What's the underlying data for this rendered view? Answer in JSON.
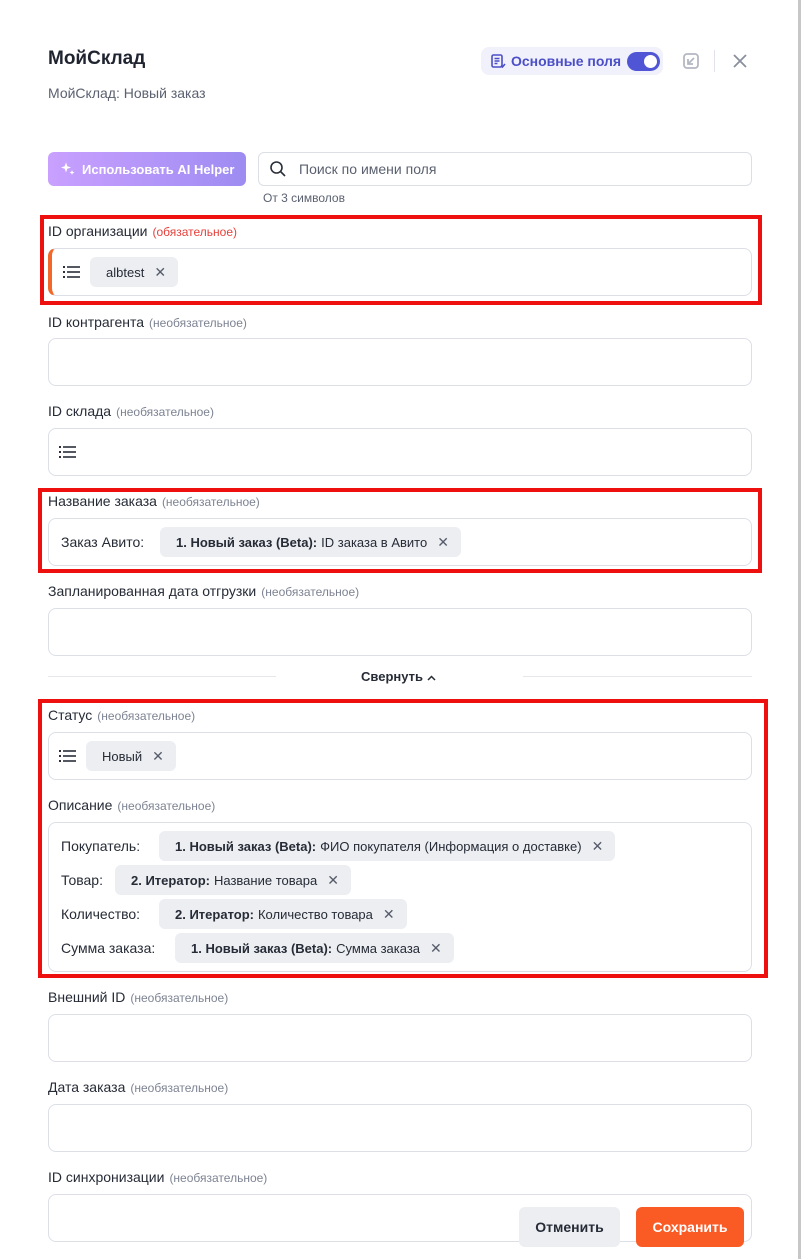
{
  "header": {
    "title": "МойСклад",
    "subtitle": "МойСклад: Новый заказ",
    "fields_toggle_label": "Основные поля",
    "fields_toggle_on": true
  },
  "toolbar": {
    "ai_button_label": "Использовать AI Helper",
    "search_placeholder": "Поиск по имени поля",
    "search_hint": "От 3 символов"
  },
  "fields": {
    "org_id": {
      "label": "ID организации",
      "tag": "(обязательное)",
      "chip": "albtest"
    },
    "counterparty_id": {
      "label": "ID контрагента",
      "tag": "(необязательное)"
    },
    "store_id": {
      "label": "ID склада",
      "tag": "(необязательное)"
    },
    "order_name": {
      "label": "Название заказа",
      "tag": "(необязательное)",
      "prefix": "Заказ Авито:",
      "chip_source": "1. Новый заказ (Beta):",
      "chip_value": "ID заказа в Авито"
    },
    "ship_date": {
      "label": "Запланированная дата отгрузки",
      "tag": "(необязательное)"
    },
    "collapse_label": "Свернуть",
    "status": {
      "label": "Статус",
      "tag": "(необязательное)",
      "chip": "Новый"
    },
    "description": {
      "label": "Описание",
      "tag": "(необязательное)",
      "rows": [
        {
          "prefix": "Покупатель:",
          "source": "1. Новый заказ (Beta):",
          "value": "ФИО покупателя (Информация о доставке)"
        },
        {
          "prefix": "Товар:",
          "source": "2. Итератор:",
          "value": "Название товара"
        },
        {
          "prefix": "Количество:",
          "source": "2. Итератор:",
          "value": "Количество товара"
        },
        {
          "prefix": "Сумма заказа:",
          "source": "1. Новый заказ (Beta):",
          "value": "Сумма заказа"
        }
      ]
    },
    "external_id": {
      "label": "Внешний ID",
      "tag": "(необязательное)"
    },
    "order_date": {
      "label": "Дата заказа",
      "tag": "(необязательное)"
    },
    "sync_id": {
      "label": "ID синхронизации",
      "tag": "(необязательное)"
    }
  },
  "footer": {
    "cancel_label": "Отменить",
    "save_label": "Сохранить"
  },
  "colors": {
    "accent": "#4b4fc7",
    "save": "#fa5a24",
    "required": "#e5413b",
    "highlight": "#ee0f0f"
  },
  "icons": [
    "fields-list-icon",
    "restore-icon",
    "close-icon",
    "sparkle-icon",
    "search-icon",
    "list-icon",
    "remove-chip-icon",
    "chevron-up-icon"
  ]
}
